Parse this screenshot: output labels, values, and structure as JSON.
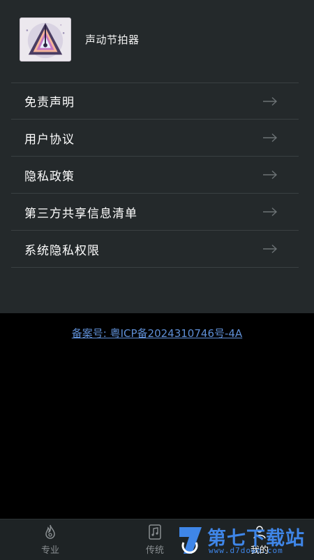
{
  "app": {
    "name": "声动节拍器"
  },
  "menu": {
    "items": [
      {
        "label": "免责声明"
      },
      {
        "label": "用户协议"
      },
      {
        "label": "隐私政策"
      },
      {
        "label": "第三方共享信息清单"
      },
      {
        "label": "系统隐私权限"
      }
    ]
  },
  "footer": {
    "icp": "备案号: 粤ICP备2024310746号-4A"
  },
  "tabbar": {
    "tabs": [
      {
        "label": "专业",
        "icon": "flame-icon"
      },
      {
        "label": "传统",
        "icon": "music-book-icon"
      },
      {
        "label": "我的",
        "icon": "person-icon",
        "active": true
      }
    ]
  },
  "watermark": {
    "text": "第七下载站",
    "url": "www.d7down.com"
  },
  "colors": {
    "panel": "#24292b",
    "link": "#5f8fd6",
    "watermark": "#3f86e8",
    "tabbar": "#1e2325"
  }
}
